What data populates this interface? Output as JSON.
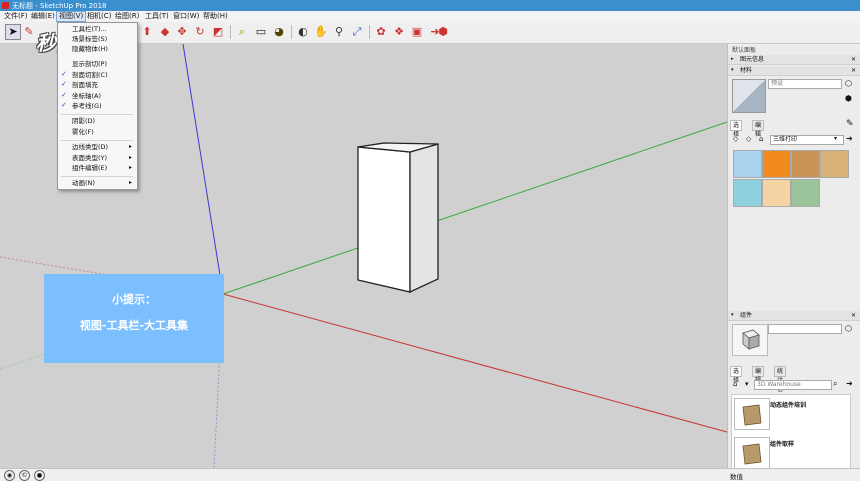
{
  "window": {
    "title": "无标题 - SketchUp Pro 2018"
  },
  "menubar": [
    "文件(F)",
    "编辑(E)",
    "视图(V)",
    "相机(C)",
    "绘图(R)",
    "工具(T)",
    "窗口(W)",
    "帮助(H)"
  ],
  "watermark": "秒懂视频",
  "view_menu": {
    "items": [
      {
        "label": "工具栏(T)..."
      },
      {
        "label": "场景标签(S)"
      },
      {
        "label": "隐藏物体(H)"
      },
      {
        "label": "显示剖切(P)"
      },
      {
        "label": "剖面切割(C)",
        "checked": "✓"
      },
      {
        "label": "剖面填充",
        "checked": "✓"
      },
      {
        "label": "坐标轴(A)",
        "checked": "✓"
      },
      {
        "label": "参考线(G)",
        "checked": "✓"
      },
      {
        "label": "阴影(D)"
      },
      {
        "label": "雾化(F)"
      },
      {
        "label": "边线类型(D)",
        "submenu": "▸"
      },
      {
        "label": "表面类型(Y)",
        "submenu": "▸"
      },
      {
        "label": "组件编辑(E)",
        "submenu": "▸"
      },
      {
        "label": "动画(N)",
        "submenu": "▸"
      }
    ]
  },
  "tip": {
    "line1": "小提示：",
    "line2": "视图-工具栏-大工具集"
  },
  "tray": {
    "title": "默认面板",
    "entity_info": "图元信息",
    "materials": {
      "header": "材料",
      "name_placeholder": "预设",
      "tab_select": "选择",
      "tab_edit": "编辑",
      "library": "三维打印",
      "swatch_colors": [
        "#a9d3ef",
        "#f08a1e",
        "#c99355",
        "#d9b27a",
        "#8fd0de",
        "#f4d4a2",
        "#9cc49a"
      ]
    },
    "components": {
      "header": "组件",
      "tab_select": "选择",
      "tab_edit": "编辑",
      "tab_stats": "统计信息",
      "search_placeholder": "3D Warehouse",
      "item1": "动态组件培训",
      "item2": "组件取样"
    }
  },
  "statusbar": {
    "measure_label": "数值"
  },
  "colors": {
    "accent": "#3a8fcf",
    "tip_box": "#7cbfff",
    "axis_green": "#3aa93a",
    "axis_red": "#c83232",
    "axis_blue": "#3a3ad0"
  }
}
